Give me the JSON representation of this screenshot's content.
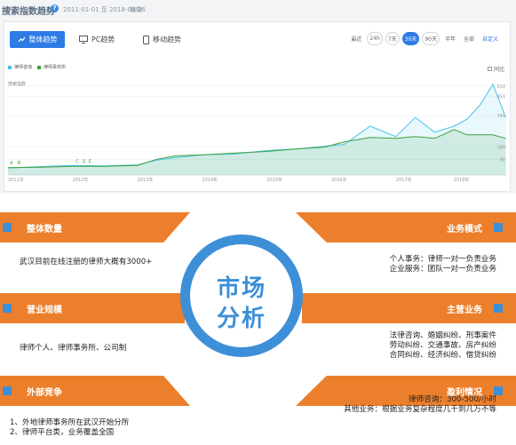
{
  "header": {
    "title": "搜索指数趋势",
    "help": "?",
    "date_range": "2011-01-01 至 2018-09-26",
    "edit": "编辑"
  },
  "tabs": {
    "overall": "整体趋势",
    "pc": "PC趋势",
    "mobile": "移动趋势"
  },
  "periods": [
    "最近",
    "24h",
    "7天",
    "30天",
    "90天",
    "半年",
    "全部",
    "自定义"
  ],
  "active_period": "30天",
  "legend": {
    "series_1": "律师咨询",
    "series_2": "律师事务所",
    "compare": "同比"
  },
  "colors": {
    "series_1": "#49c3ec",
    "series_2": "#3ca13c",
    "accent": "#2d7be5",
    "band": "#ec7f2b",
    "circle": "#3d8fd7"
  },
  "chart_data": {
    "type": "line",
    "ylabel": "搜索指数",
    "x_ticks": [
      "2011年",
      "2012年",
      "2013年",
      "2014年",
      "2015年",
      "2016年",
      "2017年",
      "2018年"
    ],
    "y_ticks": [
      90,
      160,
      340,
      450,
      510
    ],
    "ylim": [
      0,
      560
    ],
    "annotations": [
      "A",
      "B",
      "C",
      "D",
      "E"
    ],
    "series": [
      {
        "name": "律师咨询",
        "x": [
          2011.0,
          2011.5,
          2012.0,
          2012.5,
          2013.0,
          2013.3,
          2013.6,
          2014.0,
          2014.5,
          2015.0,
          2015.5,
          2015.9,
          2016.2,
          2016.6,
          2017.0,
          2017.3,
          2017.6,
          2017.9,
          2018.1,
          2018.3,
          2018.5,
          2018.7
        ],
        "values": [
          40,
          48,
          55,
          52,
          58,
          85,
          100,
          115,
          120,
          140,
          150,
          165,
          175,
          280,
          220,
          330,
          245,
          280,
          320,
          400,
          520,
          330
        ]
      },
      {
        "name": "律师事务所",
        "x": [
          2011.0,
          2011.5,
          2012.0,
          2012.5,
          2013.0,
          2013.3,
          2013.6,
          2014.0,
          2014.5,
          2015.0,
          2015.5,
          2015.9,
          2016.2,
          2016.6,
          2017.0,
          2017.3,
          2017.6,
          2017.9,
          2018.1,
          2018.3,
          2018.5,
          2018.7
        ],
        "values": [
          42,
          45,
          50,
          50,
          55,
          90,
          110,
          115,
          125,
          135,
          150,
          160,
          190,
          215,
          210,
          220,
          210,
          260,
          230,
          230,
          230,
          210
        ]
      }
    ]
  },
  "sections": {
    "overall_title": "整体数量",
    "overall_text": "武汉目前在线注册的律师大概有3000+",
    "scale_title": "营业规模",
    "scale_text": "律师个人、律师事务所、公司制",
    "competition_title": "外部竞争",
    "competition_lines": [
      "1、外地律师事务所在武汉开始分所",
      "2、律师平台类，业务覆盖全国"
    ],
    "model_title": "业务模式",
    "model_lines": [
      "个人事务：律师一对一负责业务",
      "企业服务：团队一对一负责业务"
    ],
    "main_title": "主营业务",
    "main_lines": [
      "法律咨询、婚姻纠纷、刑事案件",
      "劳动纠纷、交通事故、房产纠纷",
      "合同纠纷、经济纠纷、借贷纠纷"
    ],
    "profit_title": "盈利情况",
    "profit_lines": [
      "律师咨询：300-500/小时",
      "其他业务：根据业务复杂程度几千到几万不等"
    ],
    "center_line_1": "市场",
    "center_line_2": "分析"
  }
}
